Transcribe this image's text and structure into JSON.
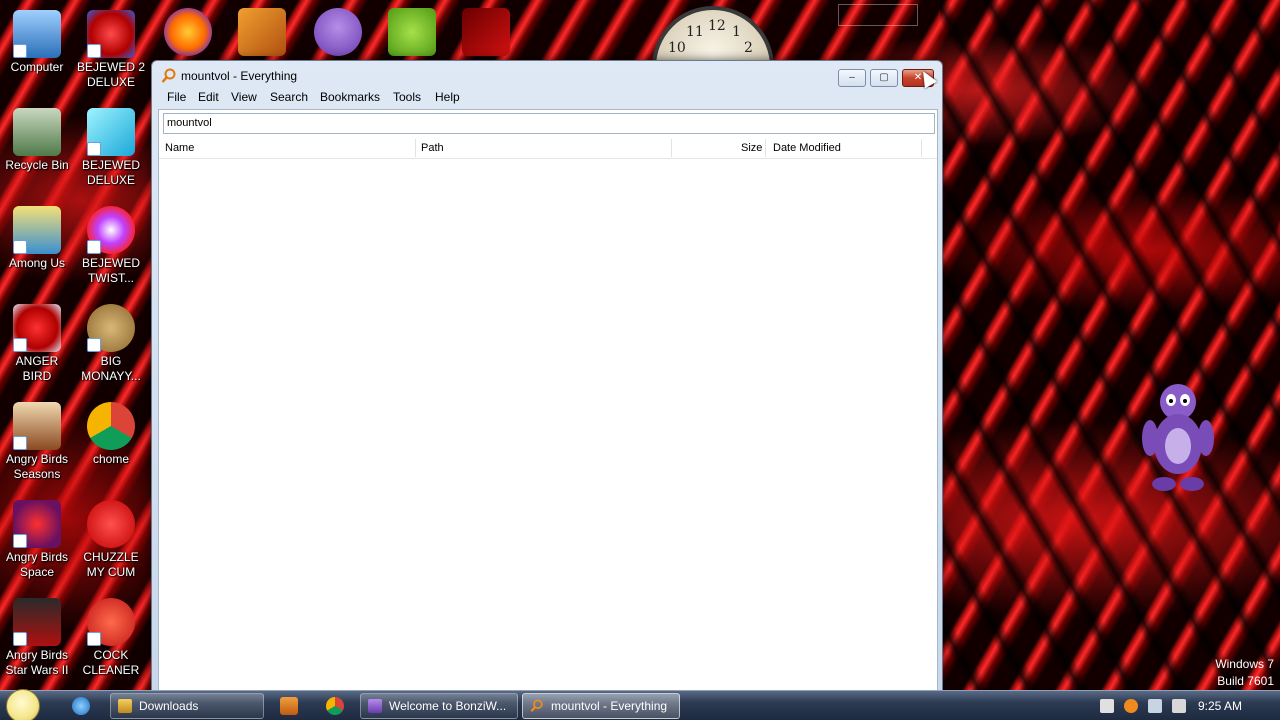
{
  "desktop": {
    "icons": [
      {
        "label": "Computer",
        "icon": "computer-icon"
      },
      {
        "label": "BEJEWED 2 DELUXE",
        "icon": "bejeweled2-icon"
      },
      {
        "label": "Recycle Bin",
        "icon": "recycle-bin-icon"
      },
      {
        "label": "BEJEWED DELUXE",
        "icon": "bejeweled-icon"
      },
      {
        "label": "Among Us",
        "icon": "among-us-icon"
      },
      {
        "label": "BEJEWED TWIST...",
        "icon": "bejeweled-twist-icon"
      },
      {
        "label": "ANGER BIRD",
        "icon": "angry-birds-icon"
      },
      {
        "label": "BIG MONAYY...",
        "icon": "money-bag-icon"
      },
      {
        "label": "Angry Birds Seasons",
        "icon": "angry-birds-seasons-icon"
      },
      {
        "label": "chome",
        "icon": "chrome-icon"
      },
      {
        "label": "Angry Birds Space",
        "icon": "angry-birds-space-icon"
      },
      {
        "label": "CHUZZLE MY CUM",
        "icon": "chuzzle-icon"
      },
      {
        "label": "Angry Birds Star Wars II",
        "icon": "angry-birds-star-wars-icon"
      },
      {
        "label": "COCK CLEANER",
        "icon": "ccleaner-icon"
      }
    ],
    "top_icons": [
      "firefox-icon",
      "game-cube-icon",
      "bonzi-buddy-icon",
      "bad-piggies-icon",
      "flash-icon"
    ],
    "clock_numbers": [
      "12",
      "10",
      "2",
      "11",
      "1"
    ],
    "os_label": {
      "line1": "Windows 7",
      "line2": "Build 7601"
    }
  },
  "window": {
    "title": "mountvol - Everything",
    "buttons": {
      "minimize": "–",
      "maximize": "▢",
      "close": "✕"
    },
    "menu": [
      "File",
      "Edit",
      "View",
      "Search",
      "Bookmarks",
      "Tools",
      "Help"
    ],
    "search": {
      "value": "mountvol",
      "placeholder": ""
    },
    "columns": [
      "Name",
      "Path",
      "Size",
      "Date Modified"
    ],
    "results": []
  },
  "taskbar": {
    "buttons": [
      {
        "label": "Downloads",
        "icon": "folder-icon",
        "active": false
      },
      {
        "label": "Welcome to BonziW...",
        "icon": "bonzi-icon",
        "active": false
      },
      {
        "label": "mountvol - Everything",
        "icon": "everything-search-icon",
        "active": true
      }
    ],
    "quick_launch": [
      "internet-explorer-icon",
      "media-player-icon",
      "chrome-icon"
    ],
    "tray_icons": [
      "action-center-icon",
      "everything-tray-icon",
      "network-icon",
      "volume-icon"
    ],
    "time": "9:25 AM"
  },
  "colors": {
    "wallpaper_red": "#e01818",
    "window_frame": "#c7d8ec",
    "close_button": "#c7432a",
    "taskbar": "#2c3a52"
  }
}
